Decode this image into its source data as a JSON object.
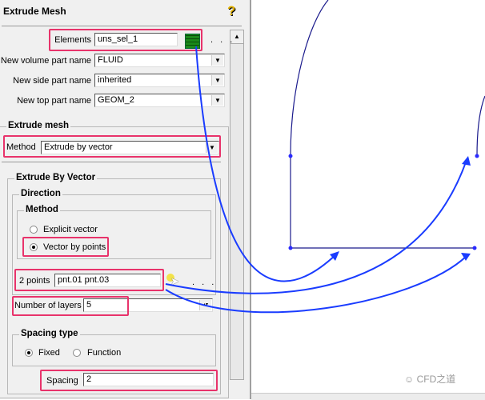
{
  "panel": {
    "title": "Extrude Mesh",
    "help_icon": "question-icon",
    "elements_label": "Elements",
    "elements_value": "uns_sel_1",
    "select_icon": "mesh-select-icon",
    "more": ". . .",
    "volume_label": "New volume part name",
    "volume_value": "FLUID",
    "side_label": "New side part name",
    "side_value": "inherited",
    "top_label": "New top part name",
    "top_value": "GEOM_2",
    "extrude_group": "Extrude mesh",
    "method_label": "Method",
    "method_value": "Extrude by vector",
    "vector_group": "Extrude By Vector",
    "direction_group": "Direction",
    "dir_method_group": "Method",
    "radio_explicit": "Explicit vector",
    "radio_points": "Vector by points",
    "points_label": "2 points",
    "points_value": "pnt.01 pnt.03",
    "layers_label": "Number of layers",
    "layers_value": "5",
    "spacing_type_group": "Spacing type",
    "radio_fixed": "Fixed",
    "radio_function": "Function",
    "spacing_label": "Spacing",
    "spacing_value": "2"
  },
  "watermark": "CFD之道",
  "colors": {
    "highlight": "#e8336b",
    "arrow": "#1a3cff",
    "geometry": "#1a1a8c"
  }
}
